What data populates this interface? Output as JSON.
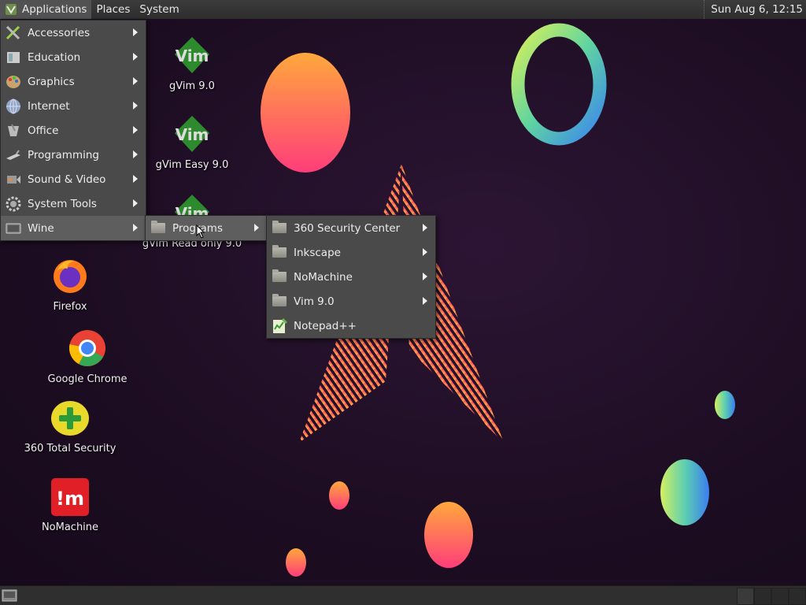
{
  "top_panel": {
    "applications": "Applications",
    "places": "Places",
    "system": "System",
    "clock": "Sun Aug  6, 12:15"
  },
  "apps_menu": {
    "items": [
      {
        "label": "Accessories",
        "icon": "accessories-icon"
      },
      {
        "label": "Education",
        "icon": "education-icon"
      },
      {
        "label": "Graphics",
        "icon": "graphics-icon"
      },
      {
        "label": "Internet",
        "icon": "internet-globe-icon"
      },
      {
        "label": "Office",
        "icon": "office-icon"
      },
      {
        "label": "Programming",
        "icon": "programming-icon"
      },
      {
        "label": "Sound & Video",
        "icon": "sound-video-icon"
      },
      {
        "label": "System Tools",
        "icon": "system-tools-gear-icon"
      },
      {
        "label": "Wine",
        "icon": "wine-icon"
      }
    ],
    "highlighted": "Wine"
  },
  "wine_menu": {
    "items": [
      {
        "label": "Programs",
        "icon": "folder-icon"
      }
    ]
  },
  "programs_menu": {
    "items": [
      {
        "label": "360 Security Center",
        "icon": "folder-icon",
        "submenu": true
      },
      {
        "label": "Inkscape",
        "icon": "folder-icon",
        "submenu": true
      },
      {
        "label": "NoMachine",
        "icon": "folder-icon",
        "submenu": true
      },
      {
        "label": "Vim 9.0",
        "icon": "folder-icon",
        "submenu": true
      },
      {
        "label": "Notepad++",
        "icon": "notepadpp-icon",
        "submenu": false
      }
    ]
  },
  "desktop_icons": [
    {
      "label": "gVim 9.0",
      "icon": "gvim-icon"
    },
    {
      "label": "gVim Easy 9.0",
      "icon": "gvim-icon"
    },
    {
      "label": "gVim Read only 9.0",
      "icon": "gvim-icon"
    },
    {
      "label": "Firefox",
      "icon": "firefox-icon"
    },
    {
      "label": "Google Chrome",
      "icon": "chrome-icon"
    },
    {
      "label": "360 Total Security",
      "icon": "360-security-icon"
    },
    {
      "label": "NoMachine",
      "icon": "nomachine-icon"
    }
  ],
  "colors": {
    "panel": "#2f2f2f",
    "menu_bg": "#4a4a4a",
    "menu_highlight": "#5e5e5e",
    "desktop_bg": "#1e0f24"
  }
}
